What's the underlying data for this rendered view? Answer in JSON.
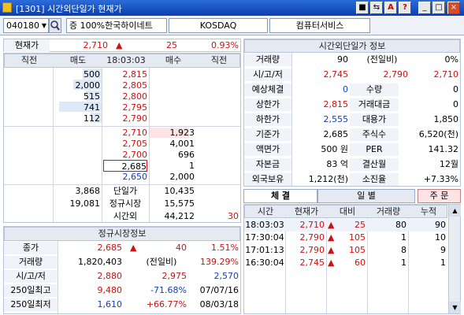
{
  "window": {
    "title": "[1301] 시간외단일가 현재가",
    "buttons": [
      "■",
      "⇆",
      "A",
      "?",
      "_",
      "□",
      "×"
    ]
  },
  "toolbar": {
    "code": "040180",
    "stock_name": "증 100%한국하이네트",
    "market": "KOSDAQ",
    "sector": "컴퓨터서비스"
  },
  "quote": {
    "label": "현재가",
    "price": "2,710",
    "change": "25",
    "rate": "0.93%"
  },
  "orderbook": {
    "headers": [
      "직전",
      "매도",
      "18:03:03",
      "매수",
      "직전"
    ],
    "asks": [
      {
        "qty": "500",
        "price": "2,815"
      },
      {
        "qty": "2,000",
        "price": "2,805"
      },
      {
        "qty": "515",
        "price": "2,800"
      },
      {
        "qty": "741",
        "price": "2,795"
      },
      {
        "qty": "112",
        "price": "2,790"
      }
    ],
    "bids": [
      {
        "price": "2,710",
        "qty": "1,923"
      },
      {
        "price": "2,705",
        "qty": "4,001"
      },
      {
        "price": "2,700",
        "qty": "696"
      },
      {
        "price": "2,685",
        "qty": "1"
      },
      {
        "price": "2,650",
        "qty": "2,000"
      }
    ],
    "summary": [
      {
        "left": "3,868",
        "label": "단일가",
        "right": "10,435",
        "extra": ""
      },
      {
        "left": "19,081",
        "label": "정규시장",
        "right": "15,575",
        "extra": ""
      },
      {
        "left": "",
        "label": "시간외",
        "right": "44,212",
        "extra": "30"
      }
    ]
  },
  "regular": {
    "title": "정규시장정보",
    "rows": [
      {
        "label": "종가",
        "a": "2,685",
        "b": "40",
        "c": "1.51%"
      },
      {
        "label": "거래량",
        "a": "1,820,403",
        "b": "(전일비)",
        "c": "139.29%"
      },
      {
        "label": "시/고/저",
        "a": "2,880",
        "b": "2,975",
        "c": "2,570"
      },
      {
        "label": "250일최고",
        "a": "9,480",
        "b": "-71.68%",
        "c": "07/07/16"
      },
      {
        "label": "250일최저",
        "a": "1,610",
        "b": "+66.77%",
        "c": "08/03/18"
      }
    ]
  },
  "info": {
    "title": "시간외단일가 정보",
    "r1": {
      "label": "거래량",
      "a": "90",
      "b": "(전일비)",
      "c": "0%"
    },
    "r2": {
      "label": "시/고/저",
      "a": "2,745",
      "b": "2,790",
      "c": "2,710"
    },
    "pairs": [
      {
        "l1": "예상체결",
        "v1": "0",
        "l2": "수량",
        "v2": "0"
      },
      {
        "l1": "상한가",
        "v1": "2,815",
        "l2": "거래대금",
        "v2": "0"
      },
      {
        "l1": "하한가",
        "v1": "2,555",
        "l2": "대용가",
        "v2": "1,850"
      },
      {
        "l1": "기준가",
        "v1": "2,685",
        "l2": "주식수",
        "v2": "6,520(천)"
      },
      {
        "l1": "액면가",
        "v1": "500 원",
        "l2": "PER",
        "v2": "141.32"
      },
      {
        "l1": "자본금",
        "v1": "83 억",
        "l2": "결산월",
        "v2": "12월"
      },
      {
        "l1": "외국보유",
        "v1": "1,212(천)",
        "l2": "소진율",
        "v2": "+7.33%"
      }
    ]
  },
  "tabs": {
    "trade": "체 결",
    "daily": "일 별",
    "order": "주 문"
  },
  "trades": {
    "headers": [
      "시간",
      "현재가",
      "대비",
      "거래량",
      "누적"
    ],
    "rows": [
      {
        "time": "18:03:03",
        "price": "2,710",
        "chg": "25",
        "vol": "80",
        "cum": "90"
      },
      {
        "time": "17:30:04",
        "price": "2,790",
        "chg": "105",
        "vol": "1",
        "cum": "10"
      },
      {
        "time": "17:01:13",
        "price": "2,790",
        "chg": "105",
        "vol": "8",
        "cum": "9"
      },
      {
        "time": "16:30:04",
        "price": "2,745",
        "chg": "60",
        "vol": "1",
        "cum": "1"
      }
    ]
  },
  "colors": {
    "red": "#d11010",
    "blue": "#1040c0",
    "ask_bar": "#dde8f8",
    "bid_bar": "#fde4e4"
  }
}
